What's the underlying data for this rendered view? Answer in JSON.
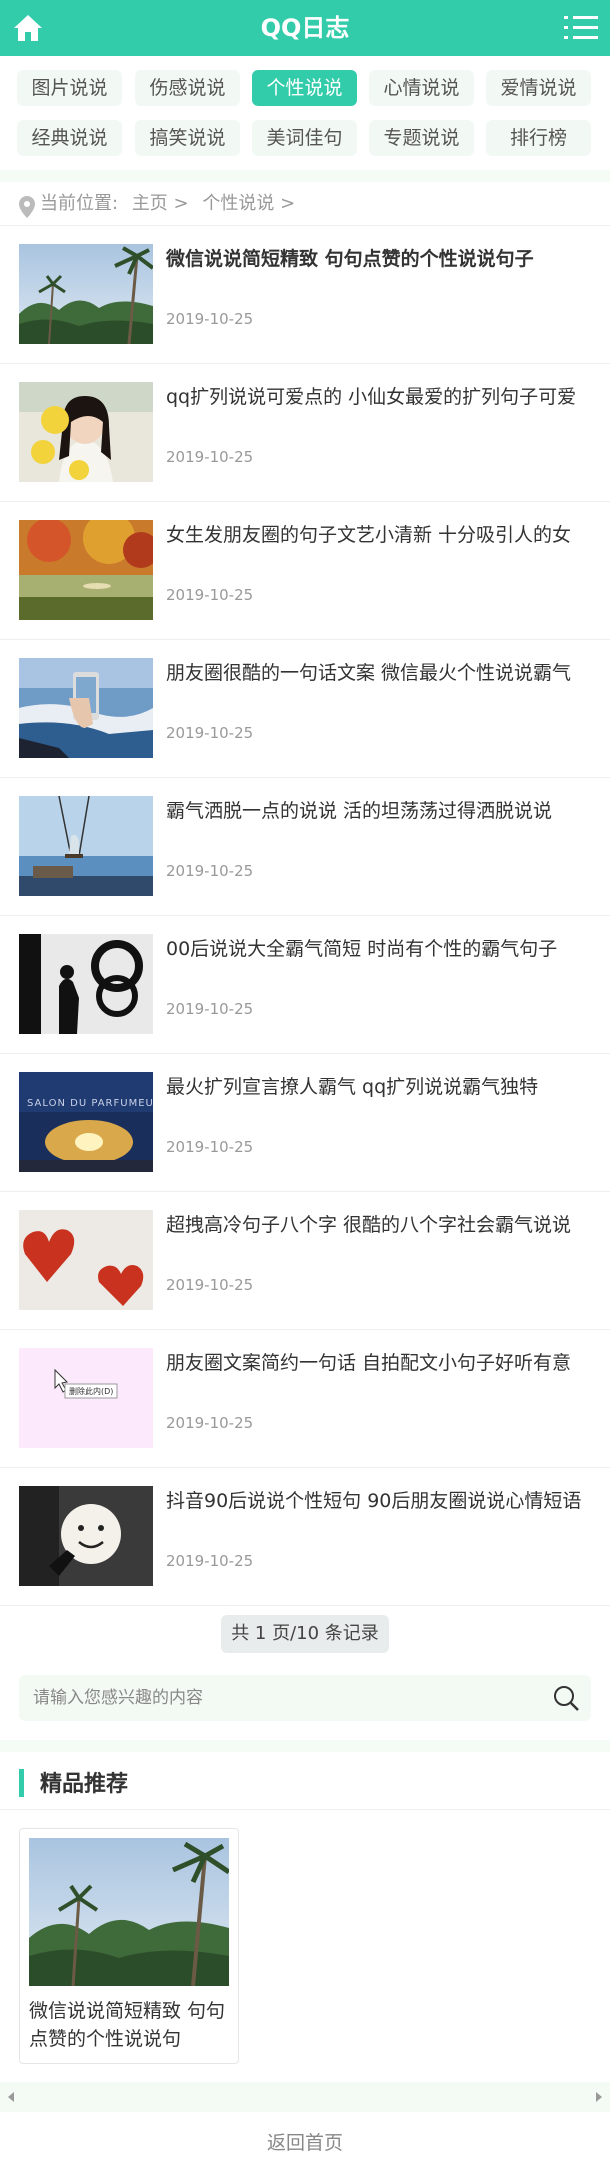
{
  "header": {
    "title": "QQ日志",
    "home_icon": "home-icon",
    "menu_icon": "menu-icon"
  },
  "categories": [
    {
      "label": "图片说说"
    },
    {
      "label": "伤感说说"
    },
    {
      "label": "个性说说"
    },
    {
      "label": "心情说说"
    },
    {
      "label": "爱情说说"
    },
    {
      "label": "经典说说"
    },
    {
      "label": "搞笑说说"
    },
    {
      "label": "美词佳句"
    },
    {
      "label": "专题说说"
    },
    {
      "label": "排行榜"
    }
  ],
  "active_category": "个性说说",
  "breadcrumb": {
    "prefix": "当前位置:",
    "home": "主页 >",
    "current": "个性说说 >"
  },
  "articles": [
    {
      "title": "微信说说简短精致 句句点赞的个性说说句子",
      "date": "2019-10-25",
      "thumb": "palm-trees"
    },
    {
      "title": "qq扩列说说可爱点的 小仙女最爱的扩列句子可爱",
      "date": "2019-10-25",
      "thumb": "girl-smiling"
    },
    {
      "title": "女生发朋友圈的句子文艺小清新 十分吸引人的女",
      "date": "2019-10-25",
      "thumb": "autumn-lake"
    },
    {
      "title": "朋友圈很酷的一句话文案 微信最火个性说说霸气",
      "date": "2019-10-25",
      "thumb": "phone-in-hand"
    },
    {
      "title": "霸气洒脱一点的说说 活的坦荡荡过得洒脱说说",
      "date": "2019-10-25",
      "thumb": "swing-by-sea"
    },
    {
      "title": "00后说说大全霸气简短 时尚有个性的霸气句子",
      "date": "2019-10-25",
      "thumb": "spiral-stairs"
    },
    {
      "title": "最火扩列宣言撩人霸气 qq扩列说说霸气独特",
      "date": "2019-10-25",
      "thumb": "salon-sign"
    },
    {
      "title": "超拽高冷句子八个字 很酷的八个字社会霸气说说",
      "date": "2019-10-25",
      "thumb": "red-hearts"
    },
    {
      "title": "朋友圈文案简约一句话 自拍配文小句子好听有意",
      "date": "2019-10-25",
      "thumb": "pink-screenshot"
    },
    {
      "title": "抖音90后说说个性短句 90后朋友圈说说心情短语",
      "date": "2019-10-25",
      "thumb": "smiley-balloon"
    }
  ],
  "pink_thumb_text": "删除此内(D)",
  "pager": {
    "text": "共 1 页/10 条记录"
  },
  "search": {
    "placeholder": "请输入您感兴趣的内容"
  },
  "recommend": {
    "title": "精品推荐",
    "items": [
      {
        "title": "微信说说简短精致 句句点赞的个性说说句",
        "thumb": "palm-trees"
      }
    ]
  },
  "footer": {
    "back_home": "返回首页"
  },
  "colors": {
    "accent": "#33ccaa",
    "band": "#f5fbf5",
    "chip": "#f2f9f4"
  }
}
